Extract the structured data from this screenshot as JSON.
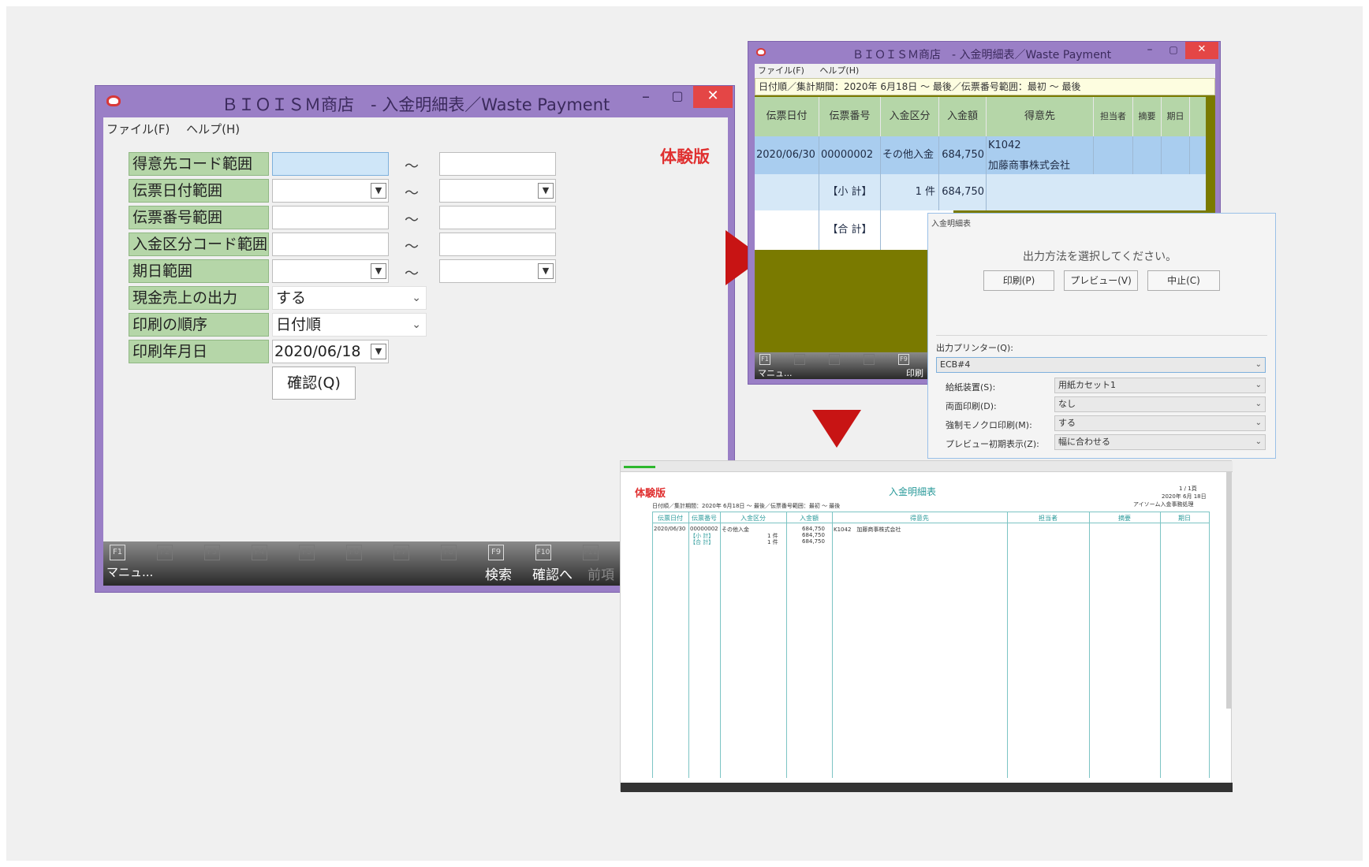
{
  "colors": {
    "window_frame": "#9a7fc6",
    "label_green": "#b5d6a8",
    "trial_red": "#e03030",
    "arrow_red": "#c81414",
    "selected_row": "#a9cdef",
    "olive": "#7a7a00",
    "report_teal": "#2a9a9a"
  },
  "search_window": {
    "title": "ＢＩＯＩＳＭ商店　- 入金明細表／Waste Payment",
    "menu": [
      "ファイル(F)",
      "ヘルプ(H)"
    ],
    "trial_label": "体験版",
    "fields": [
      {
        "label": "得意先コード範囲",
        "type": "range-text"
      },
      {
        "label": "伝票日付範囲",
        "type": "range-date"
      },
      {
        "label": "伝票番号範囲",
        "type": "range-text"
      },
      {
        "label": "入金区分コード範囲",
        "type": "range-text"
      },
      {
        "label": "期日範囲",
        "type": "range-date"
      },
      {
        "label": "現金売上の出力",
        "type": "select",
        "value": "する"
      },
      {
        "label": "印刷の順序",
        "type": "select",
        "value": "日付順"
      },
      {
        "label": "印刷年月日",
        "type": "date",
        "value": "2020/06/18"
      }
    ],
    "range_sep": "～",
    "confirm_button": "確認(Q)",
    "fkeys": [
      {
        "key": "F1",
        "caption": "マニュ..."
      },
      {
        "key": "F2",
        "caption": ""
      },
      {
        "key": "F3",
        "caption": ""
      },
      {
        "key": "F4",
        "caption": ""
      },
      {
        "key": "F5",
        "caption": ""
      },
      {
        "key": "F6",
        "caption": ""
      },
      {
        "key": "F7",
        "caption": ""
      },
      {
        "key": "F8",
        "caption": ""
      },
      {
        "key": "F9",
        "caption": "検索"
      },
      {
        "key": "F10",
        "caption": "確認へ"
      },
      {
        "key": "F11",
        "caption": "前項"
      }
    ]
  },
  "grid_window": {
    "title": "ＢＩＯＩＳＭ商店　- 入金明細表／Waste Payment",
    "menu": [
      "ファイル(F)",
      "ヘルプ(H)"
    ],
    "condition": "日付順／集計期間：2020年 6月18日 ～ 最後／伝票番号範囲：最初 ～ 最後",
    "columns": [
      "伝票日付",
      "伝票番号",
      "入金区分",
      "入金額",
      "得意先",
      "担当者",
      "摘要",
      "期日"
    ],
    "rows": [
      {
        "date": "2020/06/30",
        "number": "00000002",
        "category": "その他入金",
        "amount": "684,750",
        "customer_code": "K1042",
        "customer_name": "加藤商事株式会社"
      },
      {
        "label": "【小 計】",
        "count": "1 件",
        "amount": "684,750"
      },
      {
        "label": "【合 計】"
      }
    ],
    "fkeys": [
      {
        "key": "F1",
        "caption": "マニュ..."
      },
      {
        "key": "F9",
        "caption": "印刷"
      }
    ]
  },
  "print_dialog": {
    "title": "入金明細表",
    "prompt": "出力方法を選択してください。",
    "buttons": [
      "印刷(P)",
      "プレビュー(V)",
      "中止(C)"
    ],
    "printer_label": "出力プリンター(Q):",
    "printer_value": "ECB#4",
    "options": [
      {
        "label": "給紙装置(S):",
        "value": "用紙カセット1"
      },
      {
        "label": "両面印刷(D):",
        "value": "なし"
      },
      {
        "label": "強制モノクロ印刷(M):",
        "value": "する"
      },
      {
        "label": "プレビュー初期表示(Z):",
        "value": "幅に合わせる"
      }
    ]
  },
  "report_preview": {
    "trial_label": "体験版",
    "title": "入金明細表",
    "page": "1 / 1頁",
    "date": "2020年 6月 18日",
    "company": "アイソーム入金事務処理",
    "condition": "日付順／集計期間：2020年 6月18日 ～ 最後／伝票番号範囲：最初 ～ 最後",
    "columns": [
      "伝票日付",
      "伝票番号",
      "入金区分",
      "入金額",
      "得意先",
      "担当者",
      "摘要",
      "期日"
    ],
    "rows": [
      {
        "date": "2020/06/30",
        "number": "00000002",
        "category": "その他入金",
        "amount": "684,750",
        "customer": "K1042　加藤商事株式会社"
      },
      {
        "number": "【小 計】",
        "count": "1 件",
        "amount": "684,750"
      },
      {
        "number": "【合 計】",
        "count": "1 件",
        "amount": "684,750"
      }
    ]
  }
}
